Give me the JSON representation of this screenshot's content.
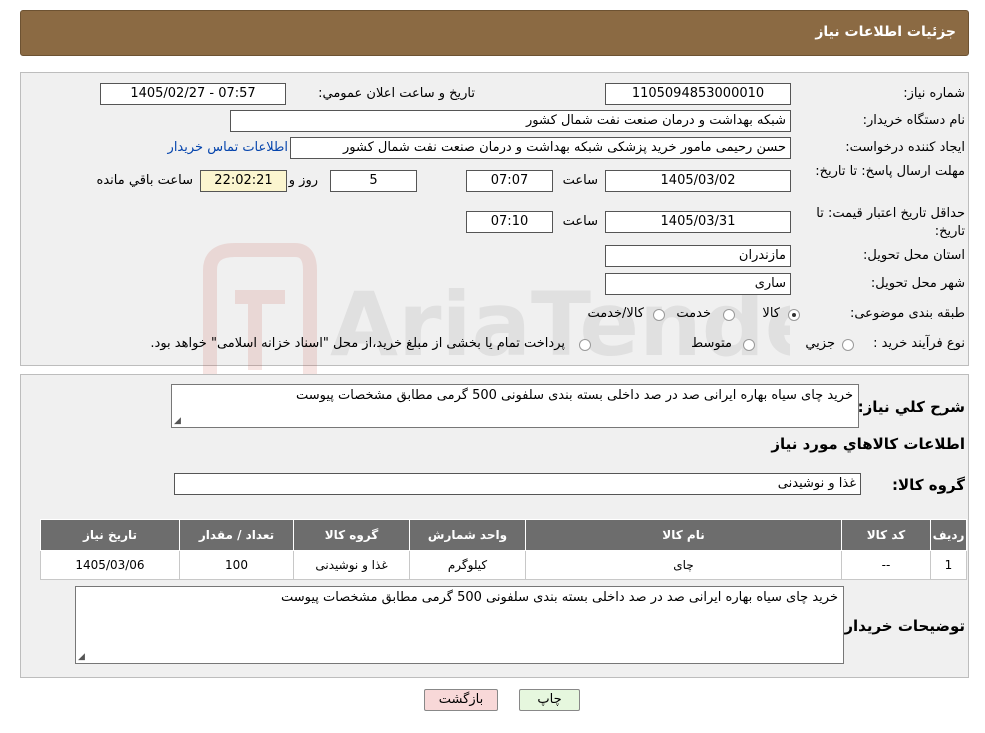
{
  "header": {
    "title": "جزئیات اطلاعات نیاز"
  },
  "form": {
    "need_number_label": "شماره نیاز:",
    "need_number": "1105094853000010",
    "announce_label": "تاريخ و ساعت اعلان عمومي:",
    "announce_value": "1405/02/27 - 07:57",
    "buyer_org_label": "نام دستگاه خريدار:",
    "buyer_org": "شبکه بهداشت و درمان صنعت نفت شمال کشور",
    "requester_label": "ايجاد کننده درخواست:",
    "requester": "حسن رحیمی مامور خرید پزشکی شبکه بهداشت و درمان صنعت نفت شمال کشور",
    "contact_link": "اطلاعات تماس خريدار",
    "deadline_label": "مهلت ارسال پاسخ: تا تاريخ:",
    "deadline_date": "1405/03/02",
    "time_label": "ساعت",
    "deadline_time": "07:07",
    "days_value": "5",
    "days_label": "روز و",
    "remaining_time": "22:02:21",
    "remaining_label": "ساعت باقي مانده",
    "validity_label": "حداقل تاريخ اعتبار قيمت: تا تاريخ:",
    "validity_date": "1405/03/31",
    "validity_time": "07:10",
    "province_label": "استان محل تحويل:",
    "province": "مازندران",
    "city_label": "شهر محل تحويل:",
    "city": "ساری",
    "category_label": "طبقه بندی موضوعی:",
    "category_options": [
      "کالا",
      "خدمت",
      "کالا/خدمت"
    ],
    "category_selected": "کالا",
    "process_label": "نوع فرآيند خريد :",
    "process_options": [
      "جزيي",
      "متوسط"
    ],
    "process_note": "پرداخت تمام يا بخشی از مبلغ خريد،از محل \"اسناد خزانه اسلامی\" خواهد بود."
  },
  "summary": {
    "desc_label": "شرح كلي نياز:",
    "description": "خرید چای سیاه بهاره ایرانی صد در صد داخلی بسته بندی سلفونی 500 گرمی  مطابق مشخصات پیوست",
    "goods_info_title": "اطلاعات کالاهاي مورد نياز",
    "goods_group_label": "گروه کالا:",
    "goods_group": "غذا و نوشیدنی",
    "table": {
      "headers": [
        "رديف",
        "کد کالا",
        "نام کالا",
        "واحد شمارش",
        "گروه کالا",
        "تعداد / مقدار",
        "تاريخ نياز"
      ],
      "rows": [
        [
          "1",
          "--",
          "چای",
          "کیلوگرم",
          "غذا و نوشیدنی",
          "100",
          "1405/03/06"
        ]
      ]
    },
    "buyer_notes_label": "توضيحات خريدار:",
    "buyer_notes": "خرید چای  سیاه بهاره ایرانی صد در صد داخلی بسته بندی سلفونی 500 گرمی  مطابق مشخصات پیوست"
  },
  "buttons": {
    "print": "چاپ",
    "back": "بازگشت"
  },
  "watermark": {
    "text": "AriaTender.neT"
  },
  "colors": {
    "header_bg": "#8b6a43",
    "panel_bg": "#f0f0f0",
    "table_header_bg": "#6d6d6d",
    "time_box_bg": "#fbf5cf",
    "back_button_bg": "#f8d8d8",
    "print_button_bg": "#e6f7de"
  }
}
